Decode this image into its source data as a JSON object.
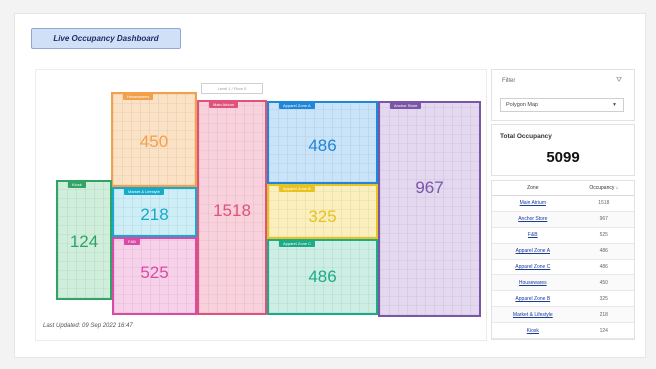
{
  "header": {
    "title": "Live Occupancy Dashboard"
  },
  "map": {
    "floor_tag": "Level 1 / Floor 0",
    "zones": [
      {
        "tag": "Housewares",
        "value": "450",
        "color": "#f2a04a",
        "fill": "#fbe2c5"
      },
      {
        "tag": "Main Atrium",
        "value": "1518",
        "color": "#e0527a",
        "fill": "#f9d1dc"
      },
      {
        "tag": "Apparel Zone A",
        "value": "486",
        "color": "#1f86d9",
        "fill": "#c9e3f8"
      },
      {
        "tag": "Anchor Store",
        "value": "967",
        "color": "#7a55a8",
        "fill": "#e3d8ef"
      },
      {
        "tag": "Kiosk",
        "value": "124",
        "color": "#2fa464",
        "fill": "#cfeedb"
      },
      {
        "tag": "Market & Lifestyle",
        "value": "218",
        "color": "#15a9cc",
        "fill": "#cdeef6"
      },
      {
        "tag": "Apparel Zone B",
        "value": "325",
        "color": "#e8c21e",
        "fill": "#fbf0bd"
      },
      {
        "tag": "F&B",
        "value": "525",
        "color": "#d94aa6",
        "fill": "#f7d1ea"
      },
      {
        "tag": "Apparel Zone C",
        "value": "486",
        "color": "#1cab86",
        "fill": "#cdeee4"
      }
    ],
    "last_updated": "Last Updated: 09 Sep 2022 16:47"
  },
  "filter": {
    "label": "Filter",
    "selected": "Polygon Map"
  },
  "total": {
    "label": "Total Occupancy",
    "value": "5099"
  },
  "table": {
    "headers": [
      "Zone",
      "Occupancy ↓"
    ],
    "rows": [
      {
        "zone": "Main Atrium",
        "occ": "1518"
      },
      {
        "zone": "Anchor Store",
        "occ": "967"
      },
      {
        "zone": "F&B",
        "occ": "525"
      },
      {
        "zone": "Apparel Zone A",
        "occ": "486"
      },
      {
        "zone": "Apparel Zone C",
        "occ": "486"
      },
      {
        "zone": "Housewares",
        "occ": "450"
      },
      {
        "zone": "Apparel Zone B",
        "occ": "325"
      },
      {
        "zone": "Market & Lifestyle",
        "occ": "218"
      },
      {
        "zone": "Kiosk",
        "occ": "124"
      }
    ]
  }
}
